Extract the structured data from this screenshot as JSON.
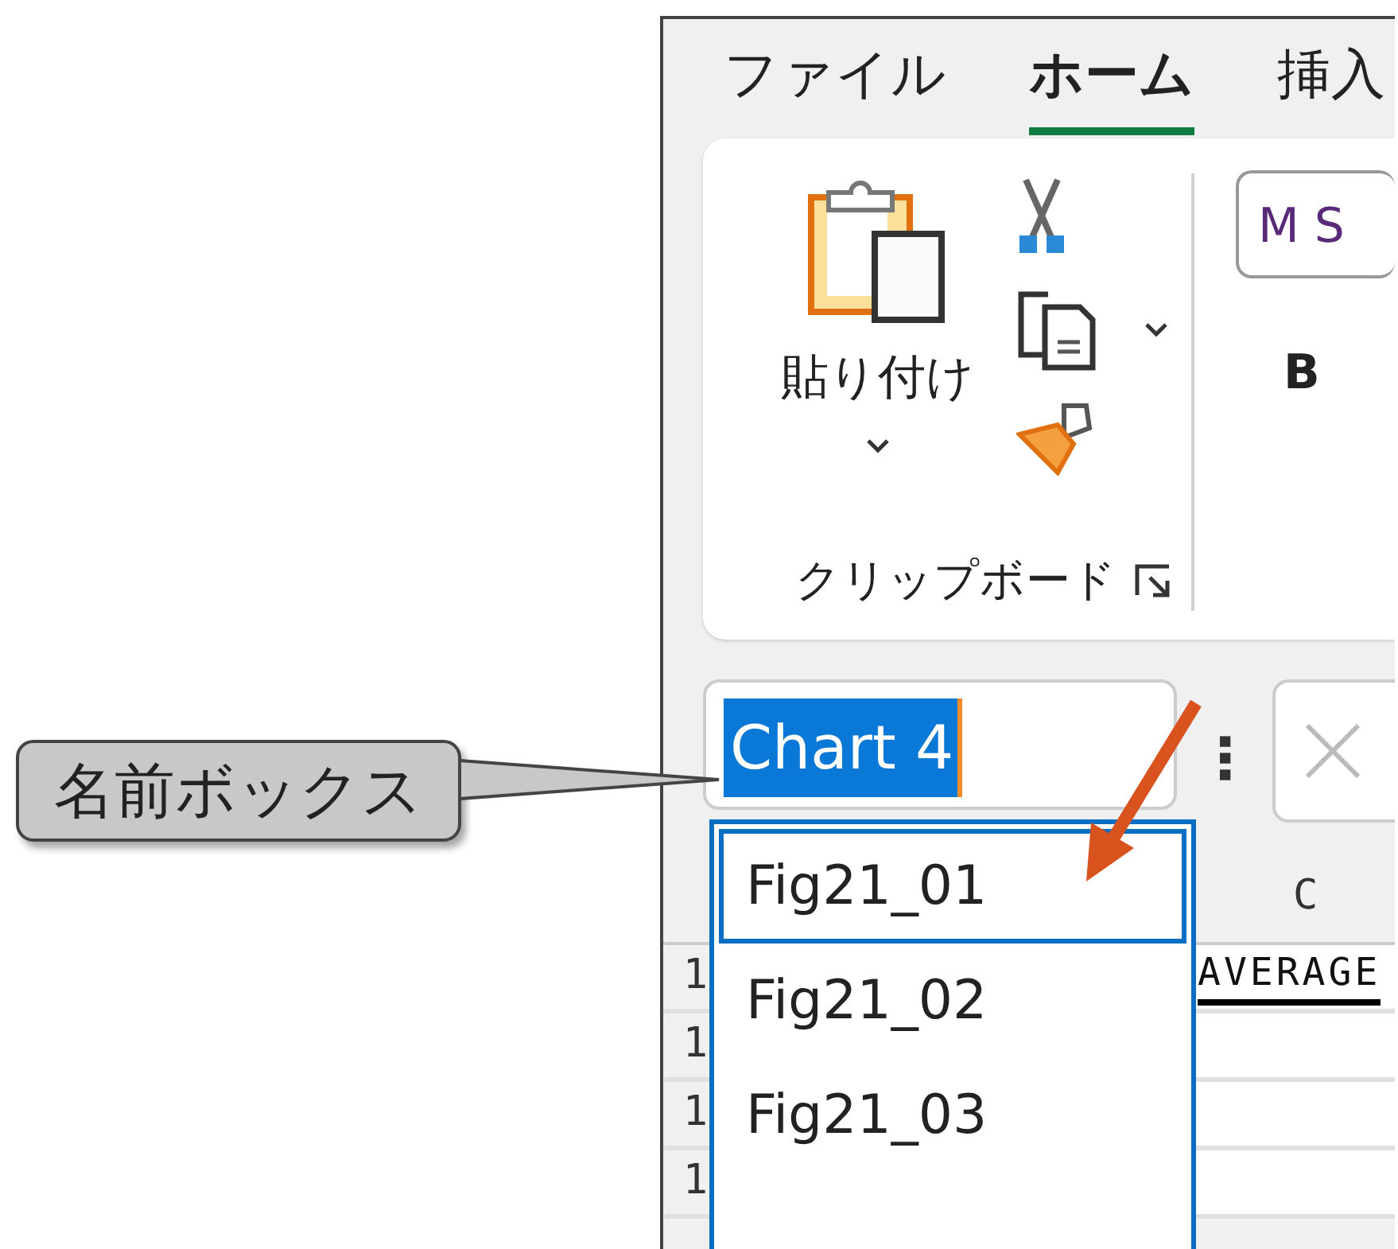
{
  "tabs": [
    {
      "label": "ファイル",
      "selected": false
    },
    {
      "label": "ホーム",
      "selected": true
    },
    {
      "label": "挿入",
      "selected": false
    }
  ],
  "clipboard": {
    "paste_label": "貼り付け",
    "group_label": "クリップボード"
  },
  "font": {
    "name": "M S",
    "bold": "B"
  },
  "name_box": {
    "value": "Chart 4"
  },
  "name_list": [
    {
      "label": "Fig21_01",
      "selected": true
    },
    {
      "label": "Fig21_02",
      "selected": false
    },
    {
      "label": "Fig21_03",
      "selected": false
    }
  ],
  "sheet": {
    "column_header": "C",
    "row_numbers": [
      "1",
      "1",
      "1",
      "1"
    ],
    "cell": "AVERAGE"
  },
  "callout": {
    "text": "名前ボックス"
  }
}
